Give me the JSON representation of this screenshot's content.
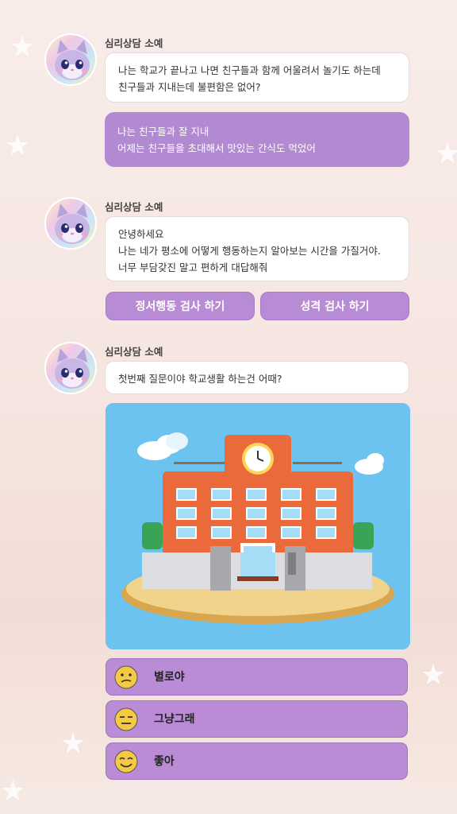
{
  "messages": [
    {
      "sender": "심리상담 소예",
      "lines": [
        "나는 학교가 끝나고 나면 친구들과 함께 어울려서 놀기도 하는데",
        "친구들과 지내는데 불편함은 없어?"
      ],
      "reply_lines": [
        "나는 친구들과 잘 지내",
        "어제는 친구들을 초대해서 맛있는 간식도 먹었어"
      ]
    },
    {
      "sender": "심리상담 소예",
      "lines": [
        "안녕하세요",
        "나는 네가 평소에 어떻게 행동하는지 알아보는 시간을 가질거야.",
        "너무 부담갖진 말고 편하게 대답해줘"
      ],
      "buttons": [
        "정서행동 검사 하기",
        "성격 검사 하기"
      ]
    },
    {
      "sender": "심리상담 소예",
      "lines": [
        "첫번째 질문이야 학교생활 하는건 어때?"
      ],
      "answers": [
        "별로야",
        "그냥그래",
        "좋아"
      ]
    }
  ],
  "icons": {
    "avatar": "cat-counselor-avatar",
    "school": "school-building-illustration",
    "faces": [
      "confused-face-icon",
      "neutral-face-icon",
      "smiling-face-icon"
    ]
  },
  "colors": {
    "accent": "#b88bd5",
    "user_bubble": "#b28ad2",
    "sky": "#6dc3ef",
    "emoji": "#f6c944"
  }
}
